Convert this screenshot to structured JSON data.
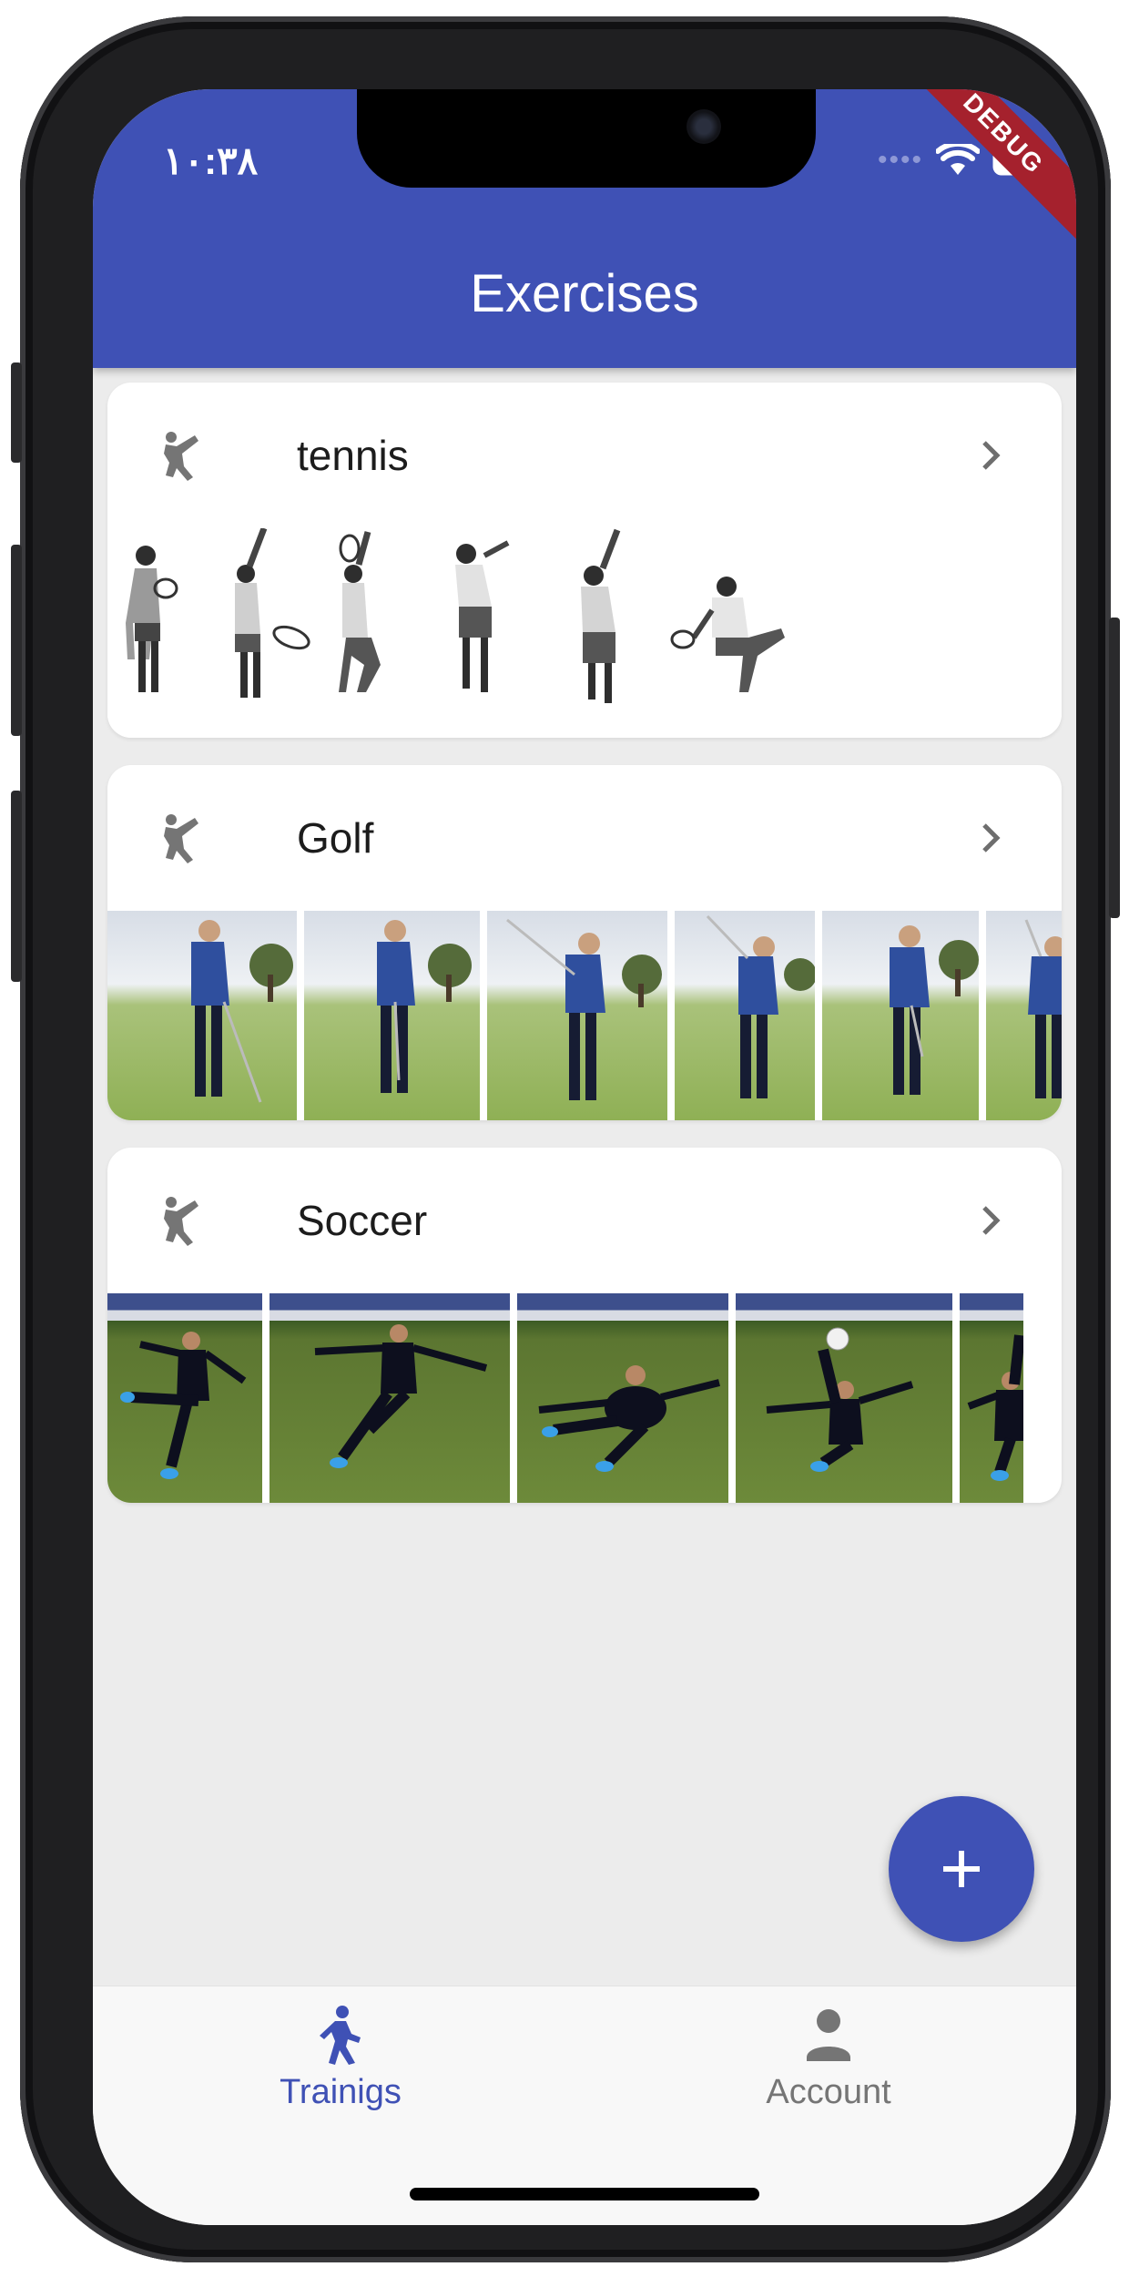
{
  "status_bar": {
    "time": "١٠:٣٨",
    "debug_banner": "DEBUG"
  },
  "app_bar": {
    "title": "Exercises"
  },
  "exercises": [
    {
      "title": "tennis",
      "icon": "martial-arts-kick-icon"
    },
    {
      "title": "Golf",
      "icon": "martial-arts-kick-icon"
    },
    {
      "title": "Soccer",
      "icon": "martial-arts-kick-icon"
    }
  ],
  "fab": {
    "icon": "plus-icon"
  },
  "bottom_nav": {
    "items": [
      {
        "label": "Trainigs",
        "icon": "walking-person-icon",
        "selected": true
      },
      {
        "label": "Account",
        "icon": "person-icon",
        "selected": false
      }
    ]
  },
  "colors": {
    "primary": "#3f51b5",
    "background": "#ececec",
    "nav_selected": "#3f51b5",
    "nav_unselected": "#757575",
    "debug_ribbon": "#a5212d"
  }
}
